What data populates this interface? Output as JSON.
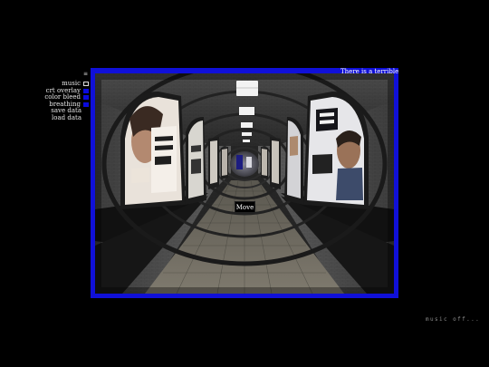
{
  "menu": {
    "toggle_icon": "hamburger-menu-icon",
    "toggle_glyph": "≡",
    "items": [
      {
        "label": "music",
        "type": "toggle",
        "state": "off"
      },
      {
        "label": "crt overlay",
        "type": "toggle",
        "state": "on"
      },
      {
        "label": "color bleed",
        "type": "toggle",
        "state": "on"
      },
      {
        "label": "breathing",
        "type": "toggle",
        "state": "on"
      },
      {
        "label": "save data",
        "type": "action"
      },
      {
        "label": "load data",
        "type": "action"
      }
    ]
  },
  "game": {
    "narration": "There is a terrible thing",
    "move_label": "Move",
    "scene": "subway-pedestrian-tunnel"
  },
  "status": {
    "music": "music off..."
  },
  "colors": {
    "background": "#000000",
    "frame": "#1010d8",
    "toggle_on": "#0a0add",
    "text": "#ffffff",
    "status_text": "#8e8e8e"
  }
}
